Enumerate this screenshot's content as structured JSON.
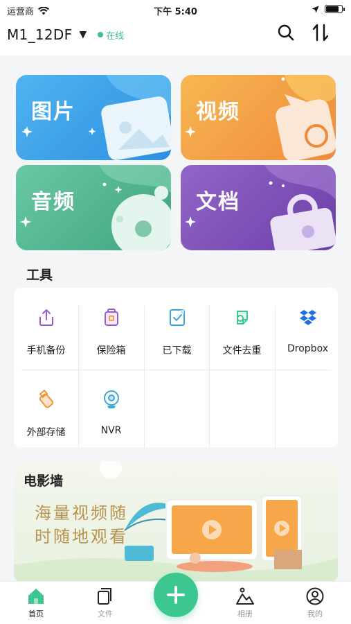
{
  "status_bar": {
    "carrier": "运营商",
    "time": "下午 5:40",
    "battery_level": 0.85
  },
  "header": {
    "device_name": "M1_12DF",
    "online_status": "在线",
    "search_icon": "search-icon",
    "transfer_icon": "transfer-icon"
  },
  "categories": [
    {
      "label": "图片",
      "color": "#3aa0e8"
    },
    {
      "label": "视频",
      "color": "#f5a044"
    },
    {
      "label": "音频",
      "color": "#4fb48e"
    },
    {
      "label": "文档",
      "color": "#7a4fb0"
    }
  ],
  "tools": {
    "title": "工具",
    "items": [
      {
        "label": "手机备份",
        "icon": "upload-icon"
      },
      {
        "label": "保险箱",
        "icon": "safe-icon"
      },
      {
        "label": "已下载",
        "icon": "downloaded-icon"
      },
      {
        "label": "文件去重",
        "icon": "dedupe-icon"
      },
      {
        "label": "Dropbox",
        "icon": "dropbox-icon"
      },
      {
        "label": "外部存储",
        "icon": "usb-storage-icon"
      },
      {
        "label": "NVR",
        "icon": "camera-icon"
      }
    ]
  },
  "movie_wall": {
    "title": "电影墙",
    "slogan_line1": "海量视频随",
    "slogan_line2": "时随地观看"
  },
  "tabbar": {
    "items": [
      {
        "label": "首页",
        "icon": "home-icon",
        "active": true
      },
      {
        "label": "文件",
        "icon": "files-icon",
        "active": false
      },
      {
        "label": "相册",
        "icon": "album-icon",
        "active": false
      },
      {
        "label": "我的",
        "icon": "profile-icon",
        "active": false
      }
    ],
    "add_icon": "plus-icon"
  },
  "colors": {
    "accent": "#3cc690",
    "online": "#3fbf8a"
  }
}
